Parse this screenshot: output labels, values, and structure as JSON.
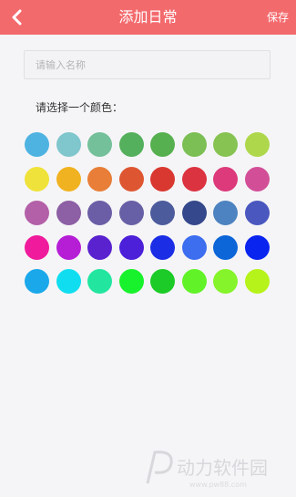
{
  "header": {
    "back_icon": "chevron-left-icon",
    "title": "添加日常",
    "save_label": "保存",
    "background": "#f36a6d"
  },
  "form": {
    "name_placeholder": "请输入名称",
    "name_value": "",
    "color_prompt": "请选择一个颜色："
  },
  "colors": [
    [
      "#4fb3e2",
      "#7fc6cd",
      "#74c09a",
      "#54b05c",
      "#56b04f",
      "#7cbf55",
      "#86c352",
      "#aed74b"
    ],
    [
      "#efe23a",
      "#f1b221",
      "#e87e37",
      "#de5631",
      "#d93830",
      "#dc3340",
      "#dc3a7a",
      "#d24f98"
    ],
    [
      "#b460a8",
      "#8d5fa4",
      "#6b5ea6",
      "#6860a6",
      "#4c5b9c",
      "#34488b",
      "#4d83c0",
      "#4a57bf"
    ],
    [
      "#f01b9c",
      "#b61ed6",
      "#5a22cf",
      "#4c1fd9",
      "#1b2ee6",
      "#3d6ef0",
      "#0c66d8",
      "#0a24f0"
    ],
    [
      "#1aa8ea",
      "#10def0",
      "#22e6a0",
      "#18f22c",
      "#1ccb27",
      "#62f228",
      "#86f42a",
      "#b6f31a"
    ]
  ],
  "watermark": {
    "text": "动力软件园",
    "url": "www.pw88.com"
  }
}
